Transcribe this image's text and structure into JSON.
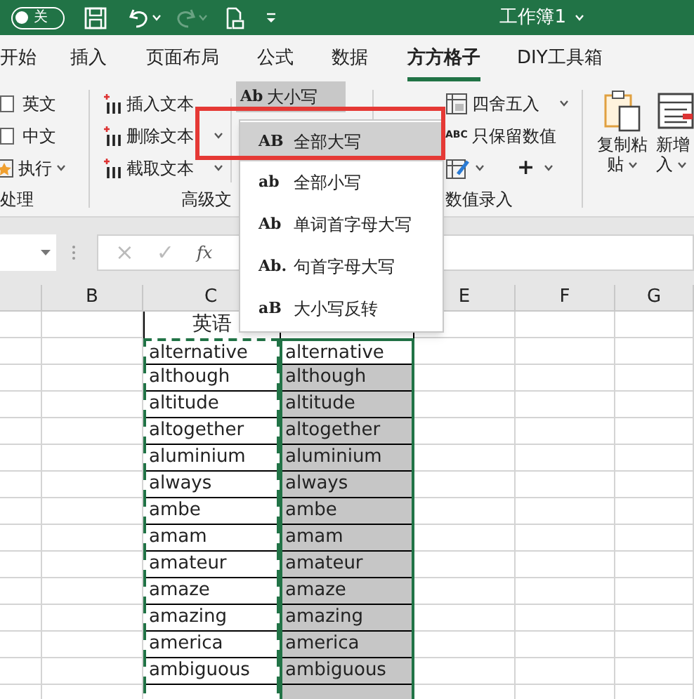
{
  "title_bar": {
    "autosave_label": "关",
    "autosave_on": false,
    "title": "工作簿1"
  },
  "tabs": [
    {
      "label": "开始",
      "selected": false
    },
    {
      "label": "插入",
      "selected": false
    },
    {
      "label": "页面布局",
      "selected": false
    },
    {
      "label": "公式",
      "selected": false
    },
    {
      "label": "数据",
      "selected": false
    },
    {
      "label": "方方格子",
      "selected": true
    },
    {
      "label": "DIY工具箱",
      "selected": false
    }
  ],
  "ribbon": {
    "process_group": {
      "label": "处理",
      "options": [
        {
          "label": "英文",
          "checked": false
        },
        {
          "label": "中文",
          "checked": false
        }
      ],
      "run_button": "执行"
    },
    "text_group": {
      "label": "高级文",
      "tools": [
        {
          "label": "插入文本",
          "dropdown": false
        },
        {
          "label": "删除文本",
          "dropdown": true
        },
        {
          "label": "截取文本",
          "dropdown": true
        }
      ],
      "case_button": {
        "icon_text": "Ab",
        "label": "大小写",
        "pressed": true
      }
    },
    "number_group": {
      "label": "数值录入",
      "round_button": "四舍五入",
      "keep_button": {
        "icon_text": "ABC",
        "label": "只保留数值"
      },
      "plus_button": "+"
    },
    "insert_group": [
      {
        "lines": [
          "复制粘",
          "贴"
        ]
      },
      {
        "lines": [
          "新增",
          "入"
        ]
      }
    ]
  },
  "formula_bar": {
    "cancel": "×",
    "enter": "✓",
    "function": "fx"
  },
  "case_menu": [
    {
      "icon_text": "AB",
      "label": "全部大写",
      "selected": true
    },
    {
      "icon_text": "ab",
      "label": "全部小写",
      "selected": false
    },
    {
      "icon_text": "Ab",
      "label": "单词首字母大写",
      "selected": false
    },
    {
      "icon_text": "Ab.",
      "label": "句首字母大写",
      "selected": false
    },
    {
      "icon_text": "aB",
      "label": "大小写反转",
      "selected": false
    }
  ],
  "sheet": {
    "column_headers": [
      "B",
      "C",
      "E",
      "F",
      "G"
    ],
    "header_cell": "英语",
    "rows": [
      {
        "c": "alternative",
        "d": "alternative",
        "selected": false
      },
      {
        "c": "although",
        "d": "although",
        "selected": true
      },
      {
        "c": "altitude",
        "d": "altitude",
        "selected": true
      },
      {
        "c": "altogether",
        "d": "altogether",
        "selected": true
      },
      {
        "c": "aluminium",
        "d": "aluminium",
        "selected": true
      },
      {
        "c": "always",
        "d": "always",
        "selected": true
      },
      {
        "c": "ambe",
        "d": "ambe",
        "selected": true
      },
      {
        "c": "amam",
        "d": "amam",
        "selected": true
      },
      {
        "c": "amateur",
        "d": "amateur",
        "selected": true
      },
      {
        "c": "amaze",
        "d": "amaze",
        "selected": true
      },
      {
        "c": "amazing",
        "d": "amazing",
        "selected": true
      },
      {
        "c": "america",
        "d": "america",
        "selected": true
      },
      {
        "c": "ambiguous",
        "d": "ambiguous",
        "selected": true
      }
    ]
  }
}
